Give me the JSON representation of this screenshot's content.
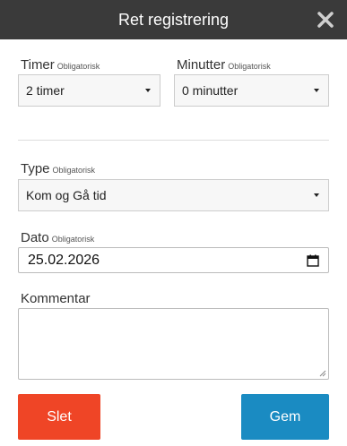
{
  "dialog": {
    "title": "Ret registrering"
  },
  "form": {
    "hours": {
      "label": "Timer",
      "required": "Obligatorisk",
      "value": "2 timer"
    },
    "minutes": {
      "label": "Minutter",
      "required": "Obligatorisk",
      "value": "0 minutter"
    },
    "type": {
      "label": "Type",
      "required": "Obligatorisk",
      "value": "Kom og Gå tid"
    },
    "date": {
      "label": "Dato",
      "required": "Obligatorisk",
      "value": "25.02.2026"
    },
    "comment": {
      "label": "Kommentar",
      "value": ""
    }
  },
  "buttons": {
    "delete_label": "Slet",
    "save_label": "Gem"
  },
  "colors": {
    "header": "#3a3a3a",
    "delete": "#ef4526",
    "save": "#1a8bc2"
  },
  "icons": [
    "close-icon",
    "chevron-down-icon",
    "calendar-icon",
    "resize-grip-icon"
  ]
}
